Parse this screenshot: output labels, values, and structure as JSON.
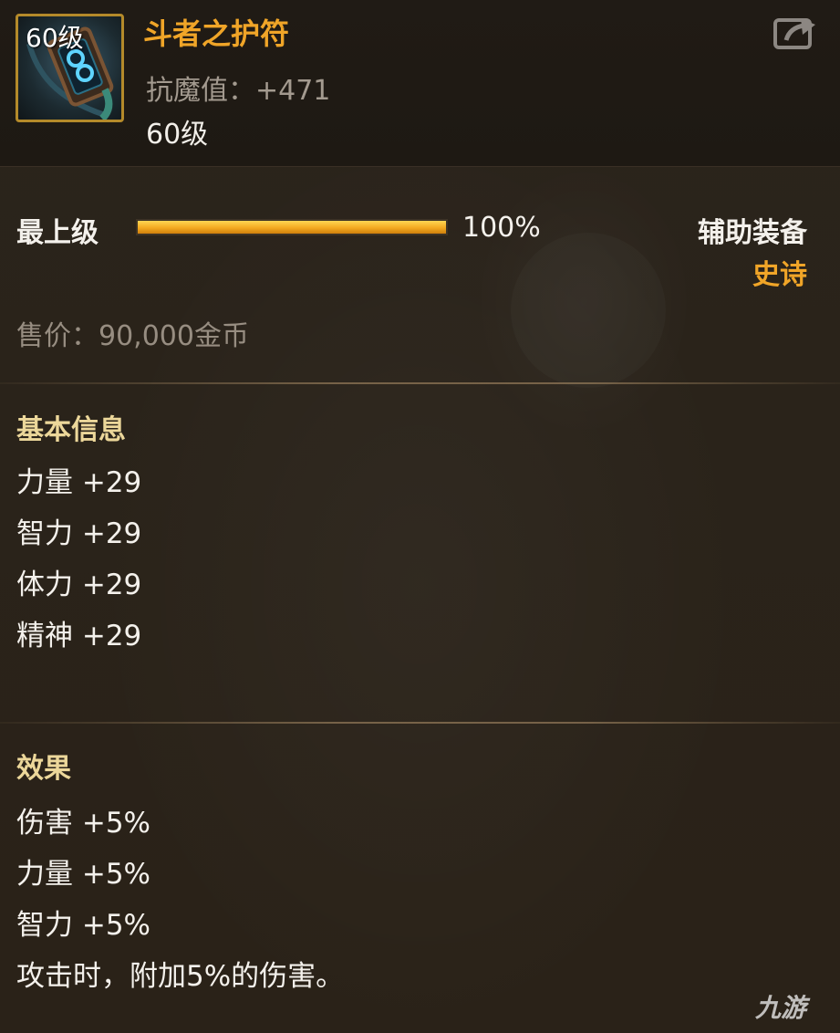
{
  "item": {
    "icon_level": "60级",
    "name": "斗者之护符",
    "stat_line": "抗魔值：+471",
    "level": "60级",
    "icon": "amulet-icon"
  },
  "share": {
    "icon": "share-icon"
  },
  "refine": {
    "label": "最上级",
    "progress_percent": 100,
    "progress_text": "100%"
  },
  "category": {
    "type": "辅助装备",
    "quality": "史诗"
  },
  "price": "售价：90,000金币",
  "basic_info": {
    "title": "基本信息",
    "stats": [
      "力量 +29",
      "智力 +29",
      "体力 +29",
      "精神 +29"
    ]
  },
  "effects": {
    "title": "效果",
    "lines": [
      "伤害 +5%",
      "力量 +5%",
      "智力 +5%",
      "攻击时，附加5%的伤害。"
    ]
  },
  "watermark": "九游",
  "colors": {
    "accent_gold": "#f0a528",
    "section_title": "#ecd79a",
    "text_white": "#f4f1ec",
    "text_muted": "#978d81",
    "background": "#2a2219"
  }
}
